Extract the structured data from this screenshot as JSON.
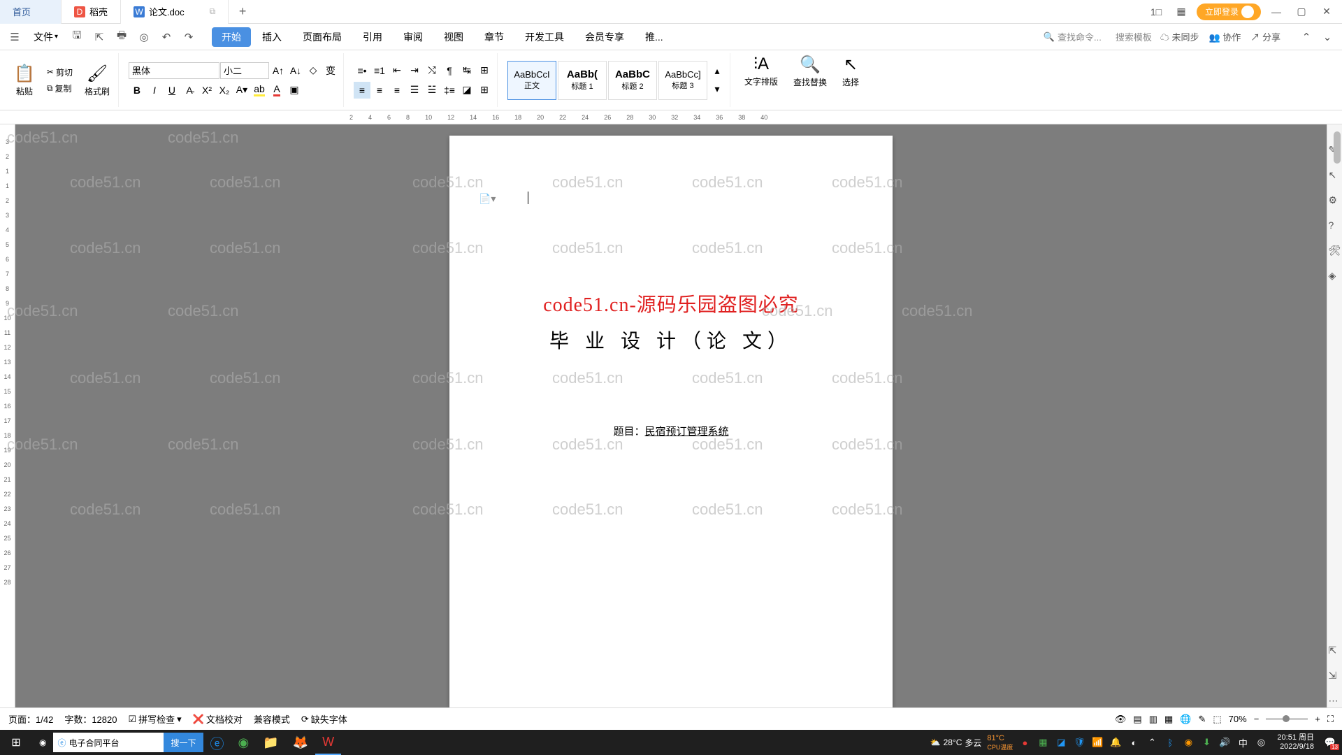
{
  "tabs": {
    "home": "首页",
    "docshell": "稻壳",
    "doc": "论文.doc"
  },
  "login": "立即登录",
  "file_menu": "文件",
  "menu": [
    "开始",
    "插入",
    "页面布局",
    "引用",
    "审阅",
    "视图",
    "章节",
    "开发工具",
    "会员专享",
    "推..."
  ],
  "search_cmd": "查找命令...",
  "search_tpl": "搜索模板",
  "sync": "未同步",
  "collab": "协作",
  "share": "分享",
  "clipboard": {
    "paste": "粘贴",
    "cut": "剪切",
    "copy": "复制",
    "fmt": "格式刷"
  },
  "font": {
    "name": "黑体",
    "size": "小二"
  },
  "styles": {
    "preview": "AaBbCcI",
    "body": "正文",
    "h1": "标题 1",
    "h2": "标题 2",
    "h3": "标题 3"
  },
  "right_ribbon": {
    "text_layout": "文字排版",
    "find_replace": "查找替换",
    "select": "选择"
  },
  "doc": {
    "title1": "code51.cn-源码乐园盗图必究",
    "title2": "毕 业 设 计（论 文）",
    "subject_label": "题目：",
    "subject_value": "民宿预订管理系统"
  },
  "status": {
    "page": "页面：1/42",
    "words": "字数：12820",
    "spell": "拼写检查",
    "proof": "文档校对",
    "compat": "兼容模式",
    "missing_font": "缺失字体",
    "zoom": "70%"
  },
  "watermark": "code51.cn",
  "taskbar": {
    "search_placeholder": "电子合同平台",
    "search_btn": "搜一下",
    "temp": "28°C",
    "weather": "多云",
    "cpu_temp": "81°C",
    "cpu_label": "CPU温度",
    "ime": "中",
    "time": "20:51 周日",
    "date": "2022/9/18",
    "badge": "13"
  }
}
